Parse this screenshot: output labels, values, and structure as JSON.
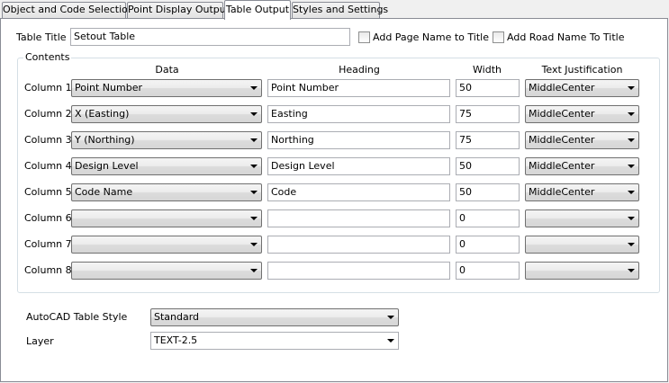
{
  "tabs": [
    {
      "label": "Object and Code Selection"
    },
    {
      "label": "Point Display Output"
    },
    {
      "label": "Table Output"
    },
    {
      "label": "Styles and Settings"
    }
  ],
  "table_title": {
    "label": "Table Title",
    "value": "Setout Table"
  },
  "checkboxes": {
    "page_name": {
      "label": "Add Page Name to Title",
      "checked": false
    },
    "road_name": {
      "label": "Add Road Name To Title",
      "checked": false
    }
  },
  "contents": {
    "legend": "Contents",
    "headers": {
      "data": "Data",
      "heading": "Heading",
      "width": "Width",
      "justification": "Text Justification"
    },
    "rows": [
      {
        "label": "Column 1",
        "data": "Point Number",
        "heading": "Point Number",
        "width": "50",
        "justification": "MiddleCenter"
      },
      {
        "label": "Column 2",
        "data": "X (Easting)",
        "heading": "Easting",
        "width": "75",
        "justification": "MiddleCenter"
      },
      {
        "label": "Column 3",
        "data": "Y (Northing)",
        "heading": "Northing",
        "width": "75",
        "justification": "MiddleCenter"
      },
      {
        "label": "Column 4",
        "data": "Design Level",
        "heading": "Design Level",
        "width": "50",
        "justification": "MiddleCenter"
      },
      {
        "label": "Column 5",
        "data": "Code Name",
        "heading": "Code",
        "width": "50",
        "justification": "MiddleCenter"
      },
      {
        "label": "Column 6",
        "data": "",
        "heading": "",
        "width": "0",
        "justification": ""
      },
      {
        "label": "Column 7",
        "data": "",
        "heading": "",
        "width": "0",
        "justification": ""
      },
      {
        "label": "Column 8",
        "data": "",
        "heading": "",
        "width": "0",
        "justification": ""
      }
    ]
  },
  "table_style": {
    "label": "AutoCAD Table Style",
    "value": "Standard"
  },
  "layer": {
    "label": "Layer",
    "value": "TEXT-2.5"
  }
}
